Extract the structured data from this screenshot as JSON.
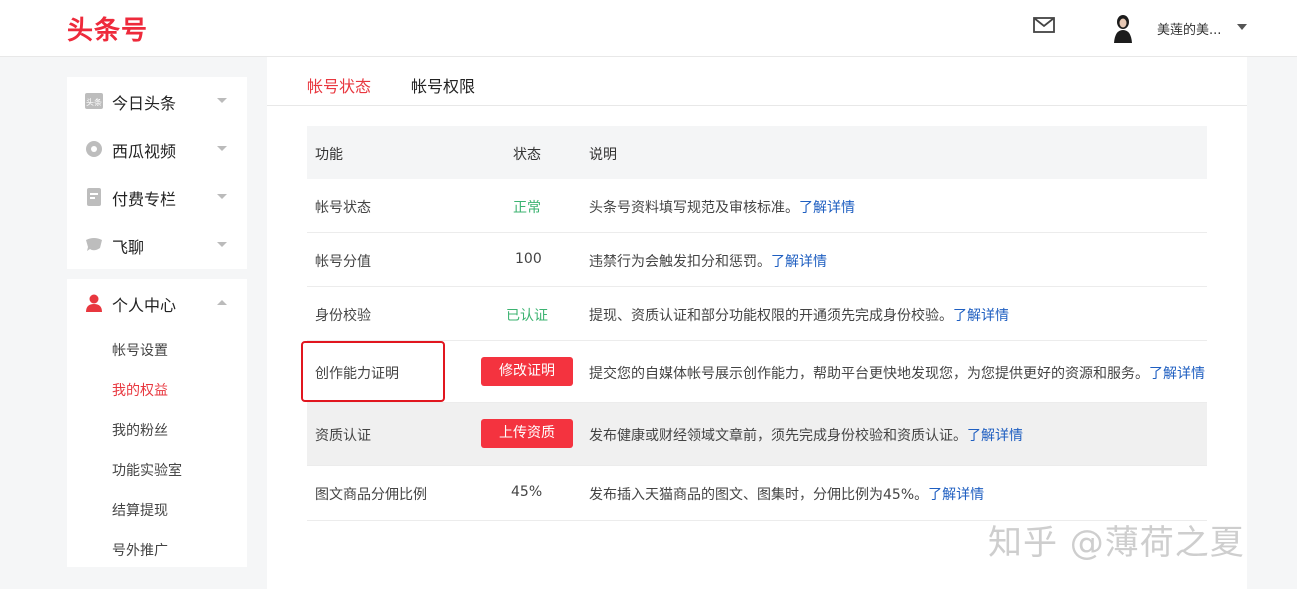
{
  "header": {
    "logo": "头条号",
    "username": "美莲的美..."
  },
  "sidebar": {
    "group1": [
      {
        "label": "今日头条",
        "icon": "toutiao-icon"
      },
      {
        "label": "西瓜视频",
        "icon": "xigua-video-icon"
      },
      {
        "label": "付费专栏",
        "icon": "paid-column-icon"
      },
      {
        "label": "飞聊",
        "icon": "feiliao-icon"
      }
    ],
    "personal_center": {
      "label": "个人中心",
      "icon": "user-icon",
      "items": [
        "帐号设置",
        "我的权益",
        "我的粉丝",
        "功能实验室",
        "结算提现",
        "号外推广"
      ],
      "active_index": 1
    }
  },
  "tabs": [
    "帐号状态",
    "帐号权限"
  ],
  "table": {
    "headers": [
      "功能",
      "状态",
      "说明"
    ],
    "rows": [
      {
        "feature": "帐号状态",
        "status": "正常",
        "status_type": "text-green",
        "desc": "头条号资料填写规范及审核标准。",
        "link": "了解详情"
      },
      {
        "feature": "帐号分值",
        "status": "100",
        "status_type": "text",
        "desc": "违禁行为会触发扣分和惩罚。",
        "link": "了解详情"
      },
      {
        "feature": "身份校验",
        "status": "已认证",
        "status_type": "text-green",
        "desc": "提现、资质认证和部分功能权限的开通须先完成身份校验。",
        "link": "了解详情"
      },
      {
        "feature": "创作能力证明",
        "status": "修改证明",
        "status_type": "button",
        "desc": "提交您的自媒体帐号展示创作能力，帮助平台更快地发现您，为您提供更好的资源和服务。",
        "link": "了解详情"
      },
      {
        "feature": "资质认证",
        "status": "上传资质",
        "status_type": "button",
        "desc": "发布健康或财经领域文章前，须先完成身份校验和资质认证。",
        "link": "了解详情"
      },
      {
        "feature": "图文商品分佣比例",
        "status": "45%",
        "status_type": "text",
        "desc": "发布插入天猫商品的图文、图集时，分佣比例为45%。",
        "link": "了解详情"
      }
    ]
  },
  "watermark": "知乎 @薄荷之夏",
  "colors": {
    "brand": "#ee2a3b",
    "accent": "#e8373f",
    "button": "#f4333f",
    "link": "#1f5fc1",
    "success": "#3cb371"
  }
}
